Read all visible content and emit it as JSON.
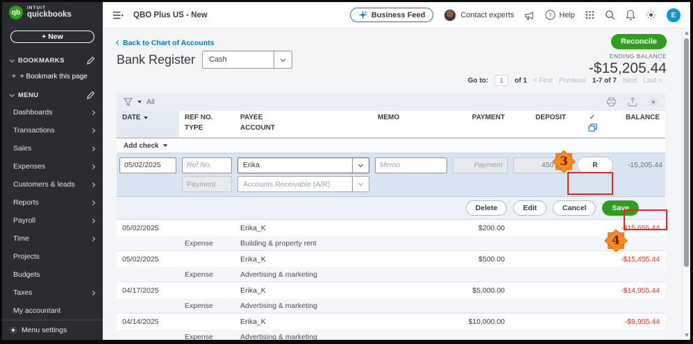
{
  "colors": {
    "brand_green": "#2ca01c",
    "link_blue": "#0077c5",
    "negative_red": "#e0352b",
    "annotation_orange": "#f68b1f",
    "annotation_red": "#e8241b"
  },
  "logo": {
    "badge": "qb",
    "line1": "INTUIT",
    "line2": "quickbooks"
  },
  "topbar": {
    "company_name": "QBO Plus US - New",
    "business_feed_label": "Business Feed",
    "contact_experts_label": "Contact experts",
    "help_label": "Help",
    "avatar_initial": "E"
  },
  "sidebar": {
    "new_button_label": "+ New",
    "bookmarks_label": "BOOKMARKS",
    "bookmark_this_page": "+ Bookmark this page",
    "menu_label": "MENU",
    "items": [
      "Dashboards",
      "Transactions",
      "Sales",
      "Expenses",
      "Customers & leads",
      "Reports",
      "Payroll",
      "Time",
      "Projects",
      "Budgets",
      "Taxes",
      "My accountant"
    ],
    "menu_settings_label": "Menu settings"
  },
  "header": {
    "back_link": "Back to Chart of Accounts",
    "title": "Bank Register",
    "account_selected": "Cash",
    "reconcile_label": "Reconcile",
    "ending_balance_label": "ENDING BALANCE",
    "ending_balance_value": "-$15,205.44"
  },
  "pagination": {
    "go_to": "Go to:",
    "page": "1",
    "of_pages": "of 1",
    "first": "< First",
    "previous": "Previous",
    "range": "1-7 of 7",
    "next": "Next",
    "last": "Last >"
  },
  "register": {
    "filter_label": "All",
    "columns": {
      "date": "DATE",
      "ref_no": "REF NO.",
      "type": "TYPE",
      "payee": "PAYEE",
      "account": "ACCOUNT",
      "memo": "MEMO",
      "payment": "PAYMENT",
      "deposit": "DEPOSIT",
      "check": "✓",
      "balance": "BALANCE"
    },
    "add_check_label": "Add check",
    "edit_row": {
      "date": "05/02/2025",
      "ref_placeholder": "Ref No.",
      "payee": "Erika",
      "type": "Payment",
      "account": "Accounts Receivable (A/R)",
      "memo_placeholder": "Memo",
      "payment_placeholder": "Payment",
      "deposit": "450.00",
      "status_button": "R",
      "balance": "-15,205.44"
    },
    "actions": {
      "delete": "Delete",
      "edit": "Edit",
      "cancel": "Cancel",
      "save": "Save"
    },
    "rows": [
      {
        "date": "05/02/2025",
        "type": "Expense",
        "payee": "Erika_K",
        "account": "Building & property rent",
        "payment": "$200.00",
        "balance": "-$15,655.44"
      },
      {
        "date": "05/02/2025",
        "type": "Expense",
        "payee": "Erika_K",
        "account": "Advertising & marketing",
        "payment": "$500.00",
        "balance": "-$15,455.44"
      },
      {
        "date": "04/17/2025",
        "type": "Expense",
        "payee": "Erika_K",
        "account": "Advertising & marketing",
        "payment": "$5,000.00",
        "balance": "-$14,955.44"
      },
      {
        "date": "04/14/2025",
        "type": "Expense",
        "payee": "Erika_K",
        "account": "Advertising & marketing",
        "payment": "$10,000.00",
        "balance": "-$9,955.44"
      }
    ]
  },
  "annotations": {
    "step3": "3",
    "step4": "4"
  }
}
